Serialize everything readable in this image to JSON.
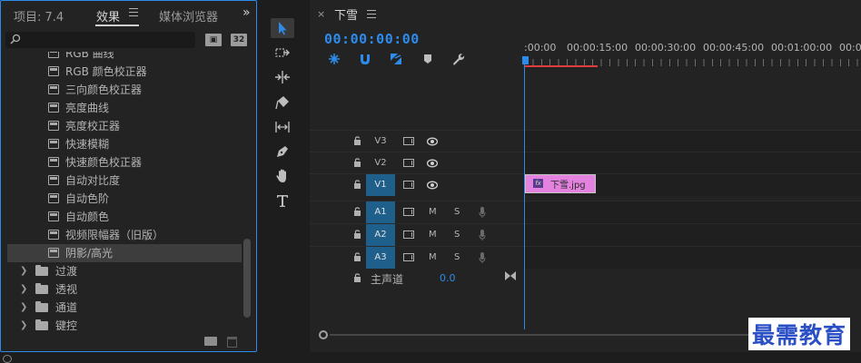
{
  "project_panel": {
    "tabs": [
      {
        "label": "项目: 7.4"
      },
      {
        "label": "效果"
      },
      {
        "label": "媒体浏览器"
      }
    ],
    "overflow": "»",
    "search": {
      "value": "",
      "placeholder": ""
    },
    "badges": [
      "32"
    ],
    "effects": [
      {
        "label": "RGB 曲线"
      },
      {
        "label": "RGB 颜色校正器"
      },
      {
        "label": "三向颜色校正器"
      },
      {
        "label": "亮度曲线"
      },
      {
        "label": "亮度校正器"
      },
      {
        "label": "快速模糊"
      },
      {
        "label": "快速颜色校正器"
      },
      {
        "label": "自动对比度"
      },
      {
        "label": "自动色阶"
      },
      {
        "label": "自动颜色"
      },
      {
        "label": "视频限幅器（旧版）"
      },
      {
        "label": "阴影/高光"
      }
    ],
    "selected_effect": "阴影/高光",
    "folders": [
      {
        "label": "过渡"
      },
      {
        "label": "透视"
      },
      {
        "label": "通道"
      },
      {
        "label": "键控"
      }
    ]
  },
  "tools": [
    "selection-tool",
    "track-select-tool",
    "ripple-edit-tool",
    "razor-tool",
    "slip-tool",
    "pen-tool",
    "hand-tool",
    "type-tool"
  ],
  "timeline": {
    "close": "×",
    "sequence_title": "下雪",
    "timecode": "00:00:00:00",
    "ruler_labels": [
      ":00:00",
      "00:00:15:00",
      "00:00:30:00",
      "00:00:45:00",
      "00:01:00:00",
      "00:0"
    ],
    "tracks": [
      {
        "label": "V3",
        "type": "video",
        "on": false
      },
      {
        "label": "V2",
        "type": "video",
        "on": false
      },
      {
        "label": "V1",
        "type": "video",
        "on": true
      },
      {
        "label": "A1",
        "type": "audio",
        "on": true
      },
      {
        "label": "A2",
        "type": "audio",
        "on": true
      },
      {
        "label": "A3",
        "type": "audio",
        "on": true
      }
    ],
    "mute_label": "M",
    "solo_label": "S",
    "clip": {
      "fx": "fx",
      "label": "下雪.jpg"
    },
    "master": {
      "label": "主声道",
      "value": "0.0"
    }
  },
  "watermark": "最需教育",
  "colors": {
    "accent": "#2d8ceb",
    "clip": "#e482e0",
    "work_area": "#e03c3c"
  }
}
